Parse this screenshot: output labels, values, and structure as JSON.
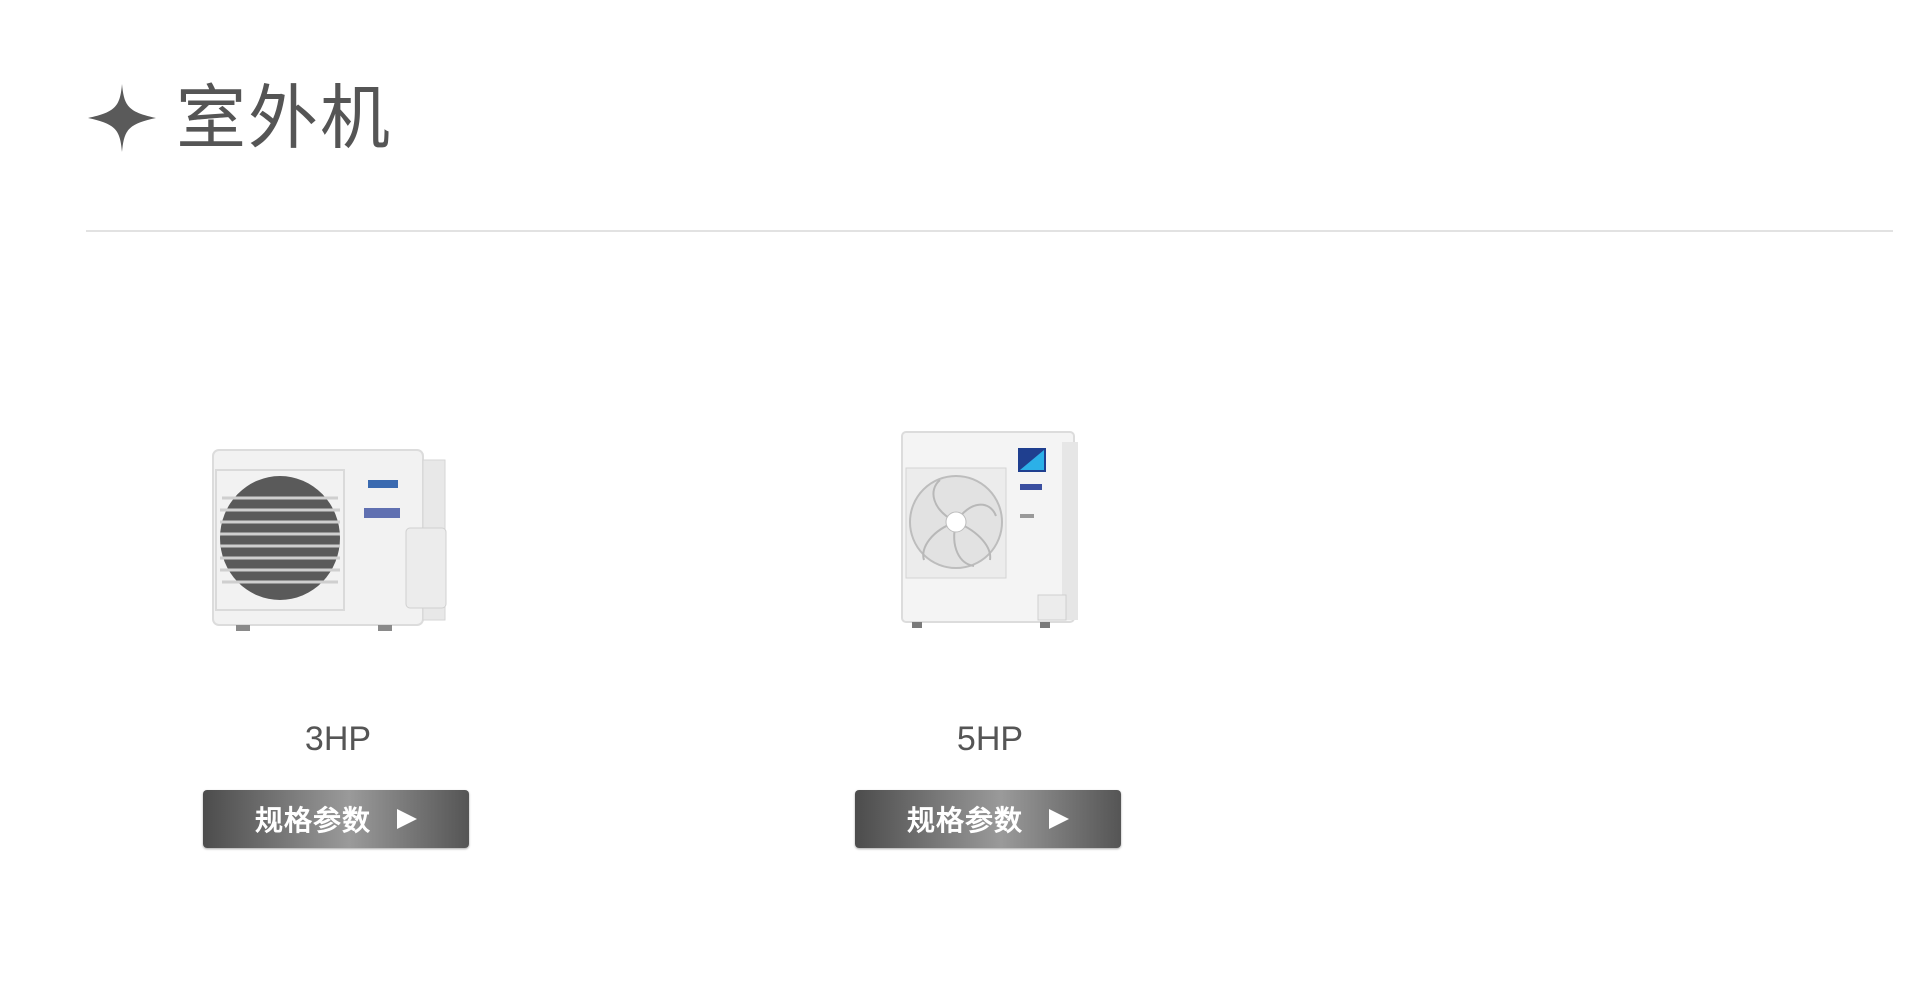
{
  "section": {
    "title": "室外机",
    "icon": "four-point-star-icon"
  },
  "products": [
    {
      "model": "3HP",
      "button_label": "规格参数",
      "image_name": "outdoor-unit-3hp-image"
    },
    {
      "model": "5HP",
      "button_label": "规格参数",
      "image_name": "outdoor-unit-5hp-image"
    }
  ],
  "colors": {
    "title": "#555555",
    "divider": "#e2e2e2",
    "button_dark": "#4c4c4c",
    "button_light": "#9a9a9a",
    "button_text": "#ffffff"
  }
}
